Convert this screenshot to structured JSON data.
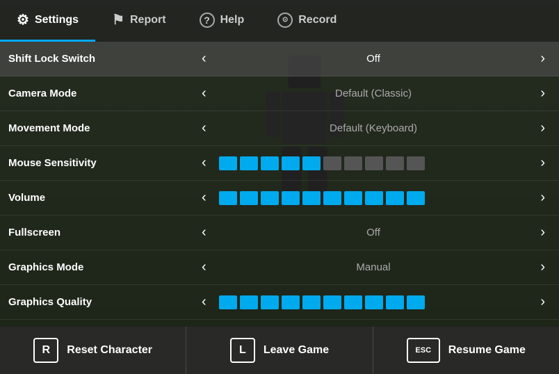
{
  "nav": {
    "tabs": [
      {
        "id": "settings",
        "label": "Settings",
        "icon": "⚙",
        "active": true
      },
      {
        "id": "report",
        "label": "Report",
        "icon": "⚑",
        "active": false
      },
      {
        "id": "help",
        "label": "Help",
        "icon": "?",
        "active": false
      },
      {
        "id": "record",
        "label": "Record",
        "icon": "⊙",
        "active": false
      }
    ]
  },
  "settings": {
    "rows": [
      {
        "id": "shift-lock",
        "label": "Shift Lock Switch",
        "type": "value",
        "value": "Off",
        "highlighted": true
      },
      {
        "id": "camera-mode",
        "label": "Camera Mode",
        "type": "value",
        "value": "Default (Classic)",
        "highlighted": false
      },
      {
        "id": "movement-mode",
        "label": "Movement Mode",
        "type": "value",
        "value": "Default (Keyboard)",
        "highlighted": false
      },
      {
        "id": "mouse-sensitivity",
        "label": "Mouse Sensitivity",
        "type": "slider",
        "filled": 5,
        "total": 10,
        "highlighted": false
      },
      {
        "id": "volume",
        "label": "Volume",
        "type": "slider",
        "filled": 10,
        "total": 10,
        "highlighted": false
      },
      {
        "id": "fullscreen",
        "label": "Fullscreen",
        "type": "value",
        "value": "Off",
        "highlighted": false
      },
      {
        "id": "graphics-mode",
        "label": "Graphics Mode",
        "type": "value",
        "value": "Manual",
        "highlighted": false
      },
      {
        "id": "graphics-quality",
        "label": "Graphics Quality",
        "type": "slider",
        "filled": 10,
        "total": 10,
        "highlighted": false
      }
    ]
  },
  "actions": [
    {
      "id": "reset",
      "key": "R",
      "label": "Reset Character"
    },
    {
      "id": "leave",
      "key": "L",
      "label": "Leave Game"
    },
    {
      "id": "resume",
      "key": "ESC",
      "label": "Resume Game"
    }
  ],
  "colors": {
    "accent": "#00aaee",
    "bg_dark": "rgba(20,20,20,0.75)",
    "nav_bg": "rgba(30,30,30,0.92)"
  }
}
